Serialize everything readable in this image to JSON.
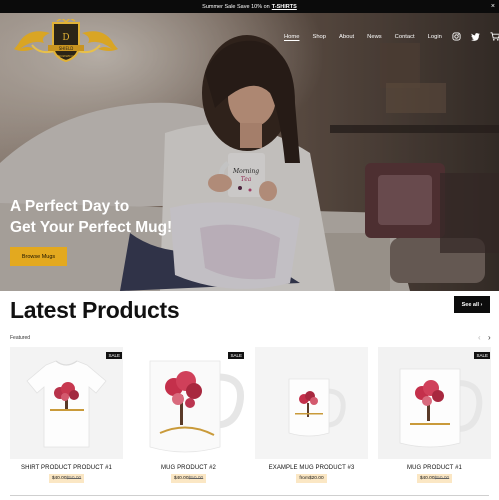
{
  "announcement": {
    "text": "Summer Sale Save 10% on",
    "link": "T-SHIRTS",
    "close": "×"
  },
  "brand": {
    "initials": "D",
    "name_line": "SHIELD",
    "caption": "KNOWLEDGE"
  },
  "nav": {
    "items": [
      "Home",
      "Shop",
      "About",
      "News",
      "Contact",
      "Login"
    ],
    "active": "Home",
    "icons": [
      "instagram-icon",
      "twitter-icon",
      "cart-icon"
    ]
  },
  "hero": {
    "title_line1": "A Perfect Day to",
    "title_line2": "Get Your Perfect Mug!",
    "button": "Browse Mugs",
    "mug_text": "Morning Tea"
  },
  "latest": {
    "title": "Latest Products",
    "see_all": "See all ›",
    "featured": "Featured",
    "prev": "‹",
    "next": "›"
  },
  "products": [
    {
      "name": "SHIRT PRODUCT PRODUCT #1",
      "badge": "SALE",
      "price_sale": "$40.00",
      "price_regular": "$50.00",
      "prefix": ""
    },
    {
      "name": "MUG PRODUCT #2",
      "badge": "SALE",
      "price_sale": "$40.00",
      "price_regular": "$50.00",
      "prefix": ""
    },
    {
      "name": "EXAMPLE MUG PRODUCT #3",
      "badge": "",
      "price_sale": "$20.00",
      "price_regular": "",
      "prefix": "from"
    },
    {
      "name": "MUG PRODUCT #1",
      "badge": "SALE",
      "price_sale": "$40.00",
      "price_regular": "$50.00",
      "prefix": ""
    }
  ],
  "colors": {
    "accent": "#e3a91f",
    "topbar": "#0b0b0b",
    "price_bg": "#fbe7c4",
    "sale_badge": "#111111"
  }
}
